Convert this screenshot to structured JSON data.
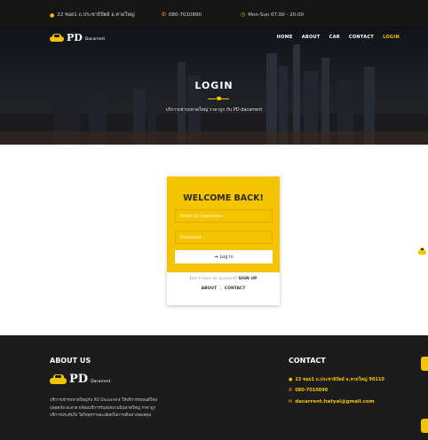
{
  "topbar": {
    "address": "22 ซอย1 ถ.ประชาธิปัตย์ อ.หาดใหญ่",
    "phone": "080-7010890",
    "hours": "Mon-Sun 07.00 - 20.00"
  },
  "header": {
    "logo_text": "PD",
    "logo_brand": "Dacarrent",
    "nav": [
      "HOME",
      "ABOUT",
      "CAR",
      "CONTACT",
      "LOGIN"
    ],
    "active_nav": "LOGIN"
  },
  "hero": {
    "title": "LOGIN",
    "subtitle": "บริการเช่ารถหาดใหญ่ ราคาถูก กับ PD dacarrent"
  },
  "login": {
    "heading": "WELCOME BACK!",
    "email_placeholder": "Email or Username",
    "password_placeholder": "Password",
    "button_label": "Log In",
    "no_account_text": "Don't have an account?",
    "signup_label": "SIGN UP",
    "about_link": "ABOUT",
    "contact_link": "CONTACT"
  },
  "footer": {
    "about_heading": "ABOUT US",
    "logo_text": "PD",
    "logo_brand": "Dacarrent",
    "about_text": "บริการเช่ารถหาดใหญ่กับ PD Dacarrent ให้บริการรถยนต์ใหม่ ปลอดภัย สะอาด พร้อมบริการรับส่งสนามบินหาดใหญ่ ราคาถูก บริการประทับใจ ใส่ใจทุกรายละเอียดในการเดินทางของคุณ",
    "contact_heading": "CONTACT",
    "contact_address": "22 ซอย1 ถ.ประชาธิปัตย์ อ.หาดใหญ่ 90110",
    "contact_phone": "080-7010890",
    "contact_email": "dacarrent.hatyai@gmail.com"
  },
  "colors": {
    "accent": "#f4c400",
    "dark": "#1c1c1c"
  }
}
